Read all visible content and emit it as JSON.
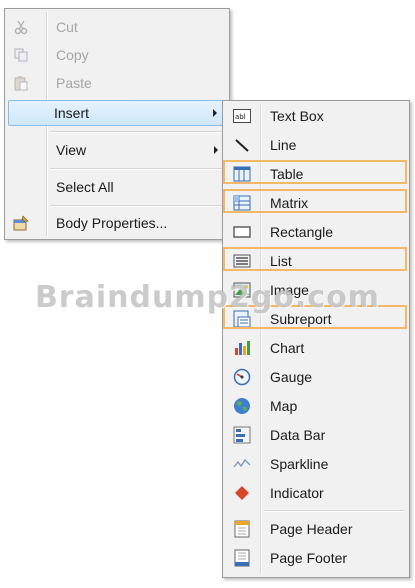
{
  "context_menu": {
    "items": [
      {
        "label": "Cut",
        "icon": "cut-icon",
        "disabled": true
      },
      {
        "label": "Copy",
        "icon": "copy-icon",
        "disabled": true
      },
      {
        "label": "Paste",
        "icon": "paste-icon",
        "disabled": true
      },
      {
        "label": "Insert",
        "submenu": true,
        "highlighted": true
      },
      {
        "label": "View",
        "submenu": true
      },
      {
        "label": "Select All"
      },
      {
        "label": "Body Properties...",
        "icon": "body-properties-icon"
      }
    ]
  },
  "insert_submenu": {
    "items": [
      {
        "label": "Text Box",
        "icon": "textbox-icon"
      },
      {
        "label": "Line",
        "icon": "line-icon"
      },
      {
        "label": "Table",
        "icon": "table-icon",
        "outlined": true
      },
      {
        "label": "Matrix",
        "icon": "matrix-icon",
        "outlined": true
      },
      {
        "label": "Rectangle",
        "icon": "rectangle-icon"
      },
      {
        "label": "List",
        "icon": "list-icon",
        "outlined": true
      },
      {
        "label": "Image",
        "icon": "image-icon"
      },
      {
        "label": "Subreport",
        "icon": "subreport-icon",
        "outlined": true
      },
      {
        "label": "Chart",
        "icon": "chart-icon"
      },
      {
        "label": "Gauge",
        "icon": "gauge-icon"
      },
      {
        "label": "Map",
        "icon": "map-icon"
      },
      {
        "label": "Data Bar",
        "icon": "databar-icon"
      },
      {
        "label": "Sparkline",
        "icon": "sparkline-icon"
      },
      {
        "label": "Indicator",
        "icon": "indicator-icon"
      },
      {
        "label": "Page Header",
        "icon": "page-header-icon"
      },
      {
        "label": "Page Footer",
        "icon": "page-footer-icon"
      }
    ]
  },
  "colors": {
    "highlight_border": "#f2b866",
    "hover_bg": "#cfe6f9",
    "disabled_text": "#a5a5a5"
  },
  "watermark": "Braindump2go.com"
}
